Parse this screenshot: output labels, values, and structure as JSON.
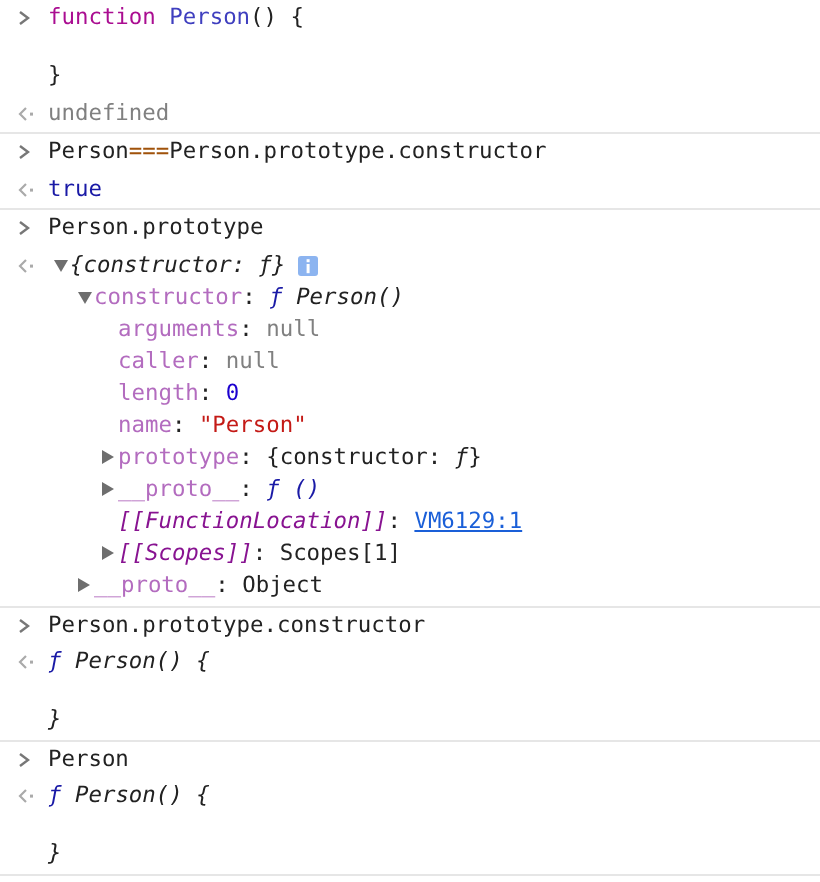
{
  "entries": [
    {
      "input": [
        {
          "kind": "code",
          "tokens": [
            {
              "t": "function ",
              "kind": "keyword"
            },
            {
              "t": "Person",
              "kind": "name"
            },
            {
              "t": "() {"
            }
          ]
        },
        {
          "kind": "blank"
        },
        {
          "kind": "code",
          "tokens": [
            {
              "t": "}"
            }
          ]
        }
      ],
      "result": {
        "kind": "text",
        "lines": [
          {
            "kind": "code",
            "tokens": [
              {
                "t": "undefined",
                "kind": "muted"
              }
            ]
          }
        ]
      }
    },
    {
      "input": [
        {
          "kind": "code",
          "tokens": [
            {
              "t": "Person"
            },
            {
              "t": "===",
              "kind": "op"
            },
            {
              "t": "Person.prototype.constructor"
            }
          ]
        }
      ],
      "result": {
        "kind": "text",
        "lines": [
          {
            "kind": "code",
            "tokens": [
              {
                "t": "true",
                "kind": "bool"
              }
            ]
          }
        ]
      }
    },
    {
      "input": [
        {
          "kind": "code",
          "tokens": [
            {
              "t": "Person.prototype"
            }
          ]
        }
      ],
      "result": {
        "kind": "tree",
        "root": {
          "expanded": true,
          "info": true,
          "tokens": [
            {
              "t": "{constructor: ",
              "kind": "italic"
            },
            {
              "t": "ƒ",
              "kind": "italic"
            },
            {
              "t": "}",
              "kind": "italic"
            }
          ],
          "children": [
            {
              "expanded": true,
              "tokens": [
                {
                  "t": "constructor",
                  "kind": "prop"
                },
                {
                  "t": ": "
                },
                {
                  "t": "ƒ ",
                  "kind": "fsign"
                },
                {
                  "t": "Person()",
                  "kind": "italic"
                }
              ],
              "children": [
                {
                  "tokens": [
                    {
                      "t": "arguments",
                      "kind": "prop"
                    },
                    {
                      "t": ": "
                    },
                    {
                      "t": "null",
                      "kind": "null"
                    }
                  ]
                },
                {
                  "tokens": [
                    {
                      "t": "caller",
                      "kind": "prop"
                    },
                    {
                      "t": ": "
                    },
                    {
                      "t": "null",
                      "kind": "null"
                    }
                  ]
                },
                {
                  "tokens": [
                    {
                      "t": "length",
                      "kind": "prop"
                    },
                    {
                      "t": ": "
                    },
                    {
                      "t": "0",
                      "kind": "num"
                    }
                  ]
                },
                {
                  "tokens": [
                    {
                      "t": "name",
                      "kind": "prop"
                    },
                    {
                      "t": ": "
                    },
                    {
                      "t": "\"Person\"",
                      "kind": "str"
                    }
                  ]
                },
                {
                  "expanded": false,
                  "tokens": [
                    {
                      "t": "prototype",
                      "kind": "prop"
                    },
                    {
                      "t": ": {constructor: "
                    },
                    {
                      "t": "ƒ",
                      "kind": "italic"
                    },
                    {
                      "t": "}"
                    }
                  ]
                },
                {
                  "expanded": false,
                  "tokens": [
                    {
                      "t": "__proto__",
                      "kind": "prop"
                    },
                    {
                      "t": ": "
                    },
                    {
                      "t": "ƒ ()",
                      "kind": "fsign"
                    }
                  ]
                },
                {
                  "tokens": [
                    {
                      "t": "[[FunctionLocation]]",
                      "kind": "internal"
                    },
                    {
                      "t": ": "
                    },
                    {
                      "t": "VM6129:1",
                      "kind": "link"
                    }
                  ]
                },
                {
                  "expanded": false,
                  "tokens": [
                    {
                      "t": "[[Scopes]]",
                      "kind": "internal"
                    },
                    {
                      "t": ": Scopes[1]"
                    }
                  ]
                }
              ]
            },
            {
              "expanded": false,
              "tokens": [
                {
                  "t": "__proto__",
                  "kind": "prop"
                },
                {
                  "t": ": Object"
                }
              ]
            }
          ]
        }
      }
    },
    {
      "input": [
        {
          "kind": "code",
          "tokens": [
            {
              "t": "Person.prototype.constructor"
            }
          ]
        }
      ],
      "result": {
        "kind": "text",
        "lines": [
          {
            "kind": "code",
            "tokens": [
              {
                "t": "ƒ ",
                "kind": "fsign"
              },
              {
                "t": "Person() {",
                "kind": "italic"
              }
            ]
          },
          {
            "kind": "blank"
          },
          {
            "kind": "code",
            "tokens": [
              {
                "t": "}",
                "kind": "italic"
              }
            ]
          }
        ]
      }
    },
    {
      "input": [
        {
          "kind": "code",
          "tokens": [
            {
              "t": "Person"
            }
          ]
        }
      ],
      "result": {
        "kind": "text",
        "lines": [
          {
            "kind": "code",
            "tokens": [
              {
                "t": "ƒ ",
                "kind": "fsign"
              },
              {
                "t": "Person() {",
                "kind": "italic"
              }
            ]
          },
          {
            "kind": "blank"
          },
          {
            "kind": "code",
            "tokens": [
              {
                "t": "}",
                "kind": "italic"
              }
            ]
          }
        ]
      }
    }
  ]
}
